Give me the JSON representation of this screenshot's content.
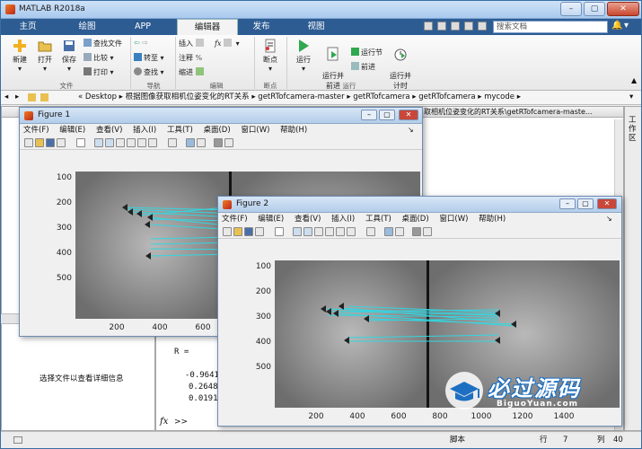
{
  "window": {
    "title": "MATLAB R2018a"
  },
  "tabs": [
    {
      "label": "主页"
    },
    {
      "label": "绘图"
    },
    {
      "label": "APP"
    },
    {
      "label": "编辑器"
    },
    {
      "label": "发布"
    },
    {
      "label": "视图"
    }
  ],
  "search": {
    "placeholder": "搜索文档"
  },
  "ribbon": {
    "file": {
      "new": "新建",
      "open": "打开",
      "save": "保存",
      "find_files": "查找文件",
      "compare": "比较",
      "print": "打印",
      "group": "文件"
    },
    "navigate": {
      "goto": "转至",
      "find": "查找",
      "group": "导航"
    },
    "edit": {
      "insert": "插入",
      "comment": "注释",
      "indent": "缩进",
      "fx": "fx",
      "group": "编辑"
    },
    "breakpoints": {
      "label": "断点",
      "group": "断点"
    },
    "run": {
      "run": "运行",
      "run_advance": "运行并\n前进",
      "run_section": "运行节",
      "advance": "前进",
      "run_time": "运行并\n计时",
      "group": "运行"
    }
  },
  "address": {
    "segments": [
      "«",
      "Desktop",
      "根据图像获取相机位姿变化的RT关系",
      "getRTofcamera-master",
      "getRTofcamera",
      "getRTofcamera",
      "mycode"
    ]
  },
  "background": {
    "editor_tab_path": "取相机位姿变化的RT关系\\getRTofcamera-maste...",
    "detail_prompt": "选择文件以查看详细信息",
    "workspace_side": "工作区",
    "command": {
      "r_label": "R =",
      "rows": [
        "-0.9641",
        "0.2648",
        "0.0191"
      ],
      "prompt": ">>"
    }
  },
  "status": {
    "script": "脚本",
    "row_label": "行",
    "row": "7",
    "col_label": "列",
    "col": "40"
  },
  "figure_menu": [
    "文件(F)",
    "编辑(E)",
    "查看(V)",
    "插入(I)",
    "工具(T)",
    "桌面(D)",
    "窗口(W)",
    "帮助(H)"
  ],
  "figure1": {
    "title": "Figure 1",
    "yticks": [
      "100",
      "200",
      "300",
      "400",
      "500"
    ],
    "xticks": [
      "200",
      "400",
      "600"
    ]
  },
  "figure2": {
    "title": "Figure 2",
    "yticks": [
      "100",
      "200",
      "300",
      "400",
      "500"
    ],
    "xticks": [
      "200",
      "400",
      "600",
      "800",
      "1000",
      "1200",
      "1400"
    ]
  },
  "watermark": {
    "text": "必过源码",
    "url": "BiguoYuan.com"
  },
  "colors": {
    "match_line": "#33d6e0",
    "tab_bar": "#2d5c93",
    "accent_orange": "#e8731c"
  }
}
